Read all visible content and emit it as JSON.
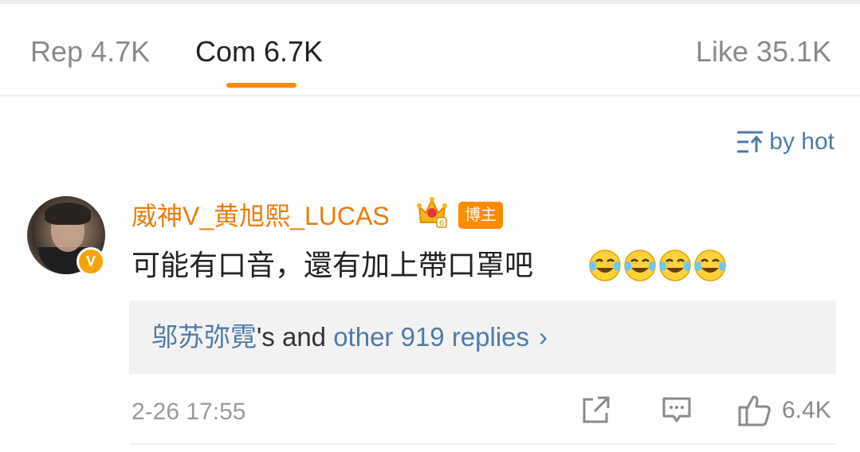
{
  "tabs": {
    "repost_label": "Rep 4.7K",
    "comment_label": "Com 6.7K",
    "like_label": "Like 35.1K",
    "active_tab": "Com",
    "accent_color": "#ff8a00"
  },
  "sort": {
    "label": "by hot",
    "icon": "sort-icon"
  },
  "comment": {
    "username": "威神V_黄旭熙_LUCAS",
    "verified_badge_text": "V",
    "blogger_badge": "博主",
    "crown_level": "6",
    "text": "可能有口音，還有加上帶口罩吧",
    "emoji_name": "laugh-cry-emoji",
    "emoji_count": 4,
    "replies": {
      "name": "邬苏弥霓",
      "connector": "'s and ",
      "other": "other 919 replies",
      "chevron": "›"
    },
    "timestamp": "2-26 17:55",
    "like_count": "6.4K"
  },
  "colors": {
    "username": "#eb7c0b",
    "link_blue": "#4f7aa8",
    "muted": "#8a8a8a"
  }
}
